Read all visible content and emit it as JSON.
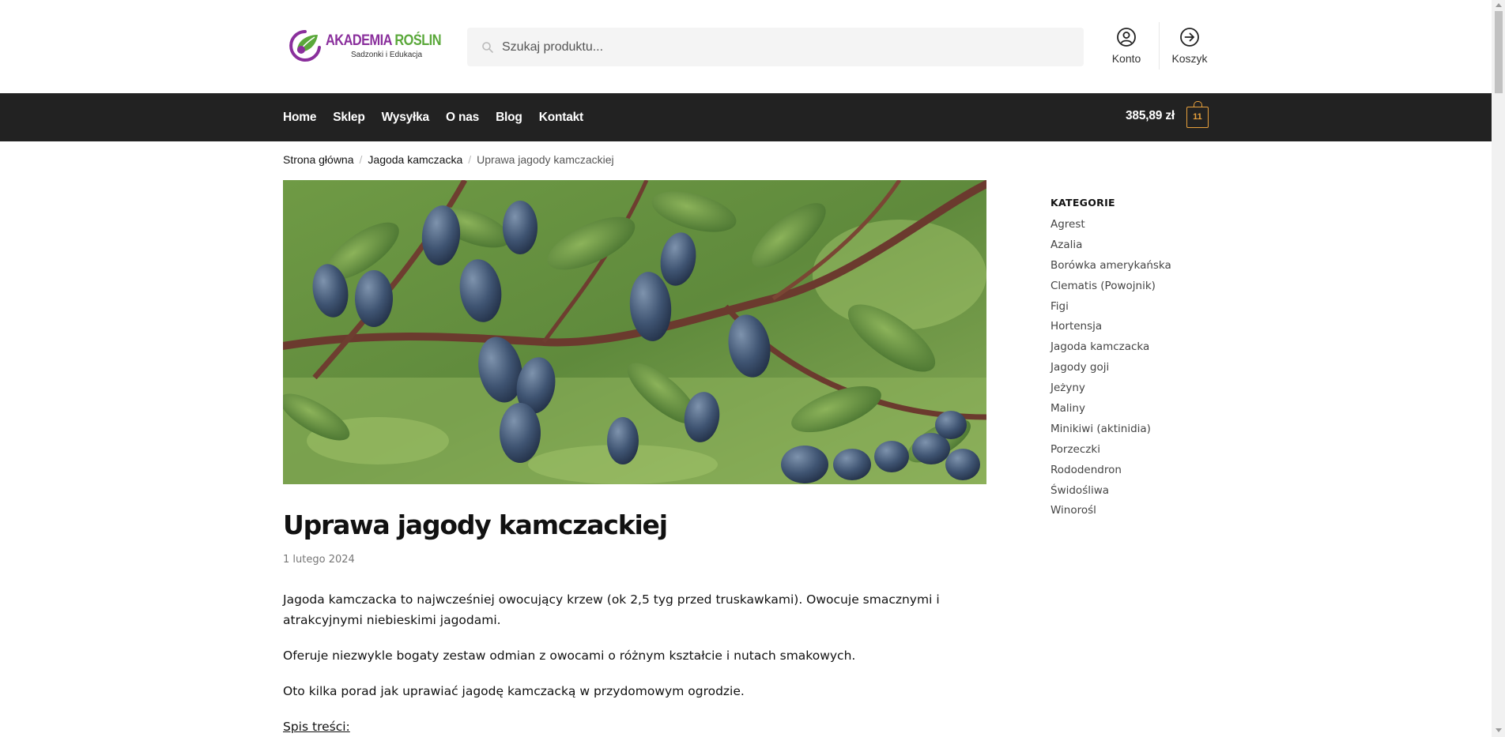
{
  "header": {
    "logo": {
      "title_part1": "AKADEMIA ",
      "title_part2": "ROŚLIN",
      "subtitle": "Sadzonki i Edukacja"
    },
    "search": {
      "placeholder": "Szukaj produktu..."
    },
    "account_label": "Konto",
    "cart_label": "Koszyk"
  },
  "nav": {
    "items": [
      "Home",
      "Sklep",
      "Wysyłka",
      "O nas",
      "Blog",
      "Kontakt"
    ],
    "cart_total": "385,89 zł",
    "cart_count": "11",
    "accent_color": "#e8a13c",
    "bar_color": "#222222"
  },
  "breadcrumb": {
    "home": "Strona główna",
    "category": "Jagoda kamczacka",
    "current": "Uprawa jagody kamczackiej"
  },
  "post": {
    "title": "Uprawa jagody kamczackiej",
    "date": "1 lutego 2024",
    "paragraphs": [
      "Jagoda kamczacka to najwcześniej owocujący krzew (ok 2,5 tyg przed truskawkami). Owocuje smacznymi i atrakcyjnymi niebieskimi jagodami.",
      "Oferuje niezwykle bogaty zestaw odmian z owocami o różnym kształcie i nutach smakowych.",
      "Oto kilka porad jak uprawiać jagodę kamczacką w przydomowym ogrodzie."
    ],
    "toc_label": "Spis treści:"
  },
  "sidebar": {
    "heading": "KATEGORIE",
    "categories": [
      "Agrest",
      "Azalia",
      "Borówka amerykańska",
      "Clematis (Powojnik)",
      "Figi",
      "Hortensja",
      "Jagoda kamczacka",
      "Jagody goji",
      "Jeżyny",
      "Maliny",
      "Minikiwi (aktinidia)",
      "Porzeczki",
      "Rododendron",
      "Świdośliwa",
      "Winorośl"
    ]
  }
}
